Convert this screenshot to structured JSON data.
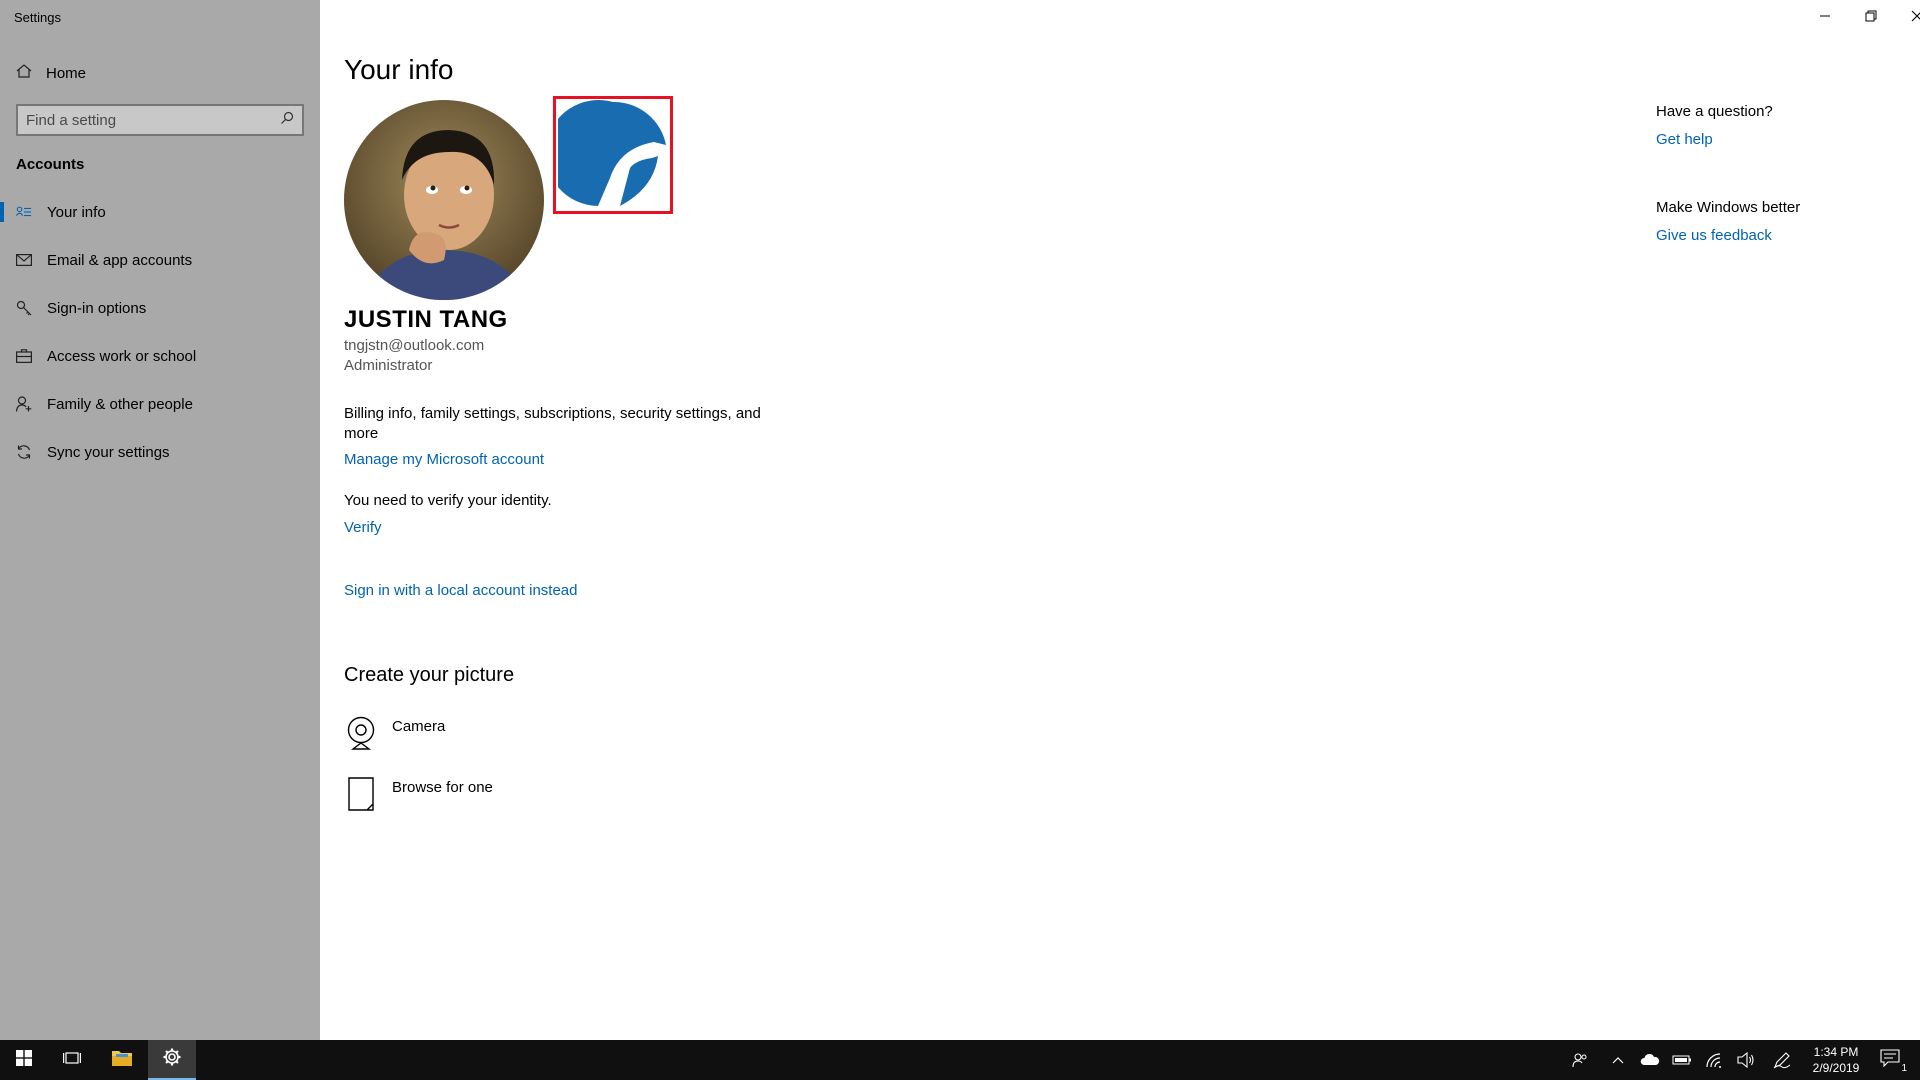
{
  "window": {
    "title": "Settings"
  },
  "sidebar": {
    "home_label": "Home",
    "search_placeholder": "Find a setting",
    "section_title": "Accounts",
    "items": [
      {
        "label": "Your info",
        "icon": "contact-card-icon",
        "active": true
      },
      {
        "label": "Email & app accounts",
        "icon": "mail-icon",
        "active": false
      },
      {
        "label": "Sign-in options",
        "icon": "key-icon",
        "active": false
      },
      {
        "label": "Access work or school",
        "icon": "briefcase-icon",
        "active": false
      },
      {
        "label": "Family & other people",
        "icon": "person-add-icon",
        "active": false
      },
      {
        "label": "Sync your settings",
        "icon": "sync-icon",
        "active": false
      }
    ]
  },
  "main": {
    "title": "Your info",
    "user": {
      "name": "JUSTIN TANG",
      "email": "tngjstn@outlook.com",
      "role": "Administrator"
    },
    "billing_text": "Billing info, family settings, subscriptions, security settings, and more",
    "manage_link": "Manage my Microsoft account",
    "verify_text": "You need to verify your identity.",
    "verify_link": "Verify",
    "local_account_link": "Sign in with a local account instead",
    "create_picture": {
      "title": "Create your picture",
      "options": [
        {
          "label": "Camera",
          "icon": "webcam-icon"
        },
        {
          "label": "Browse for one",
          "icon": "document-icon"
        }
      ]
    }
  },
  "help": {
    "question_title": "Have a question?",
    "get_help_link": "Get help",
    "better_title": "Make Windows better",
    "feedback_link": "Give us feedback"
  },
  "taskbar": {
    "time": "1:34 PM",
    "date": "2/9/2019",
    "notification_count": "1"
  },
  "colors": {
    "accent": "#0063b1",
    "sidebar_bg": "#a9a9a9",
    "highlight_frame": "#e81123",
    "taskbar_bg": "#101010"
  }
}
